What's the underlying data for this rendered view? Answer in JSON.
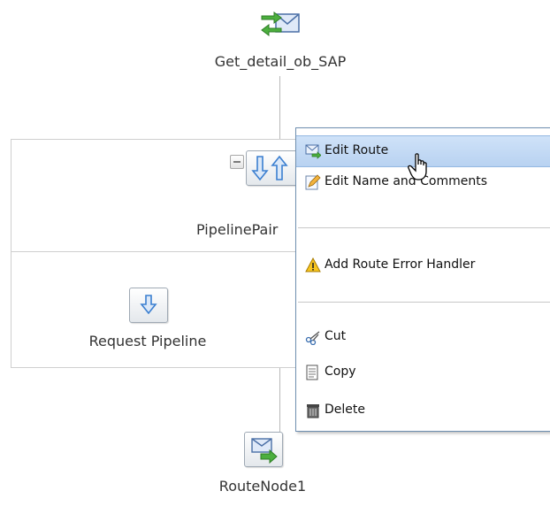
{
  "nodes": {
    "top": {
      "label": "Get_detail_ob_SAP",
      "icon": "envelope-exchange-icon"
    },
    "pipeline_pair": {
      "label": "PipelinePair"
    },
    "request_pipeline": {
      "label": "Request Pipeline"
    },
    "route_node": {
      "label": "RouteNode1"
    }
  },
  "context_menu": {
    "items": [
      {
        "label": "Edit Route",
        "icon": "edit-route-icon",
        "highlighted": true
      },
      {
        "label": "Edit Name and Comments",
        "icon": "edit-pencil-icon"
      },
      {
        "label": "Add Route Error Handler",
        "icon": "warning-icon"
      },
      {
        "label": "Cut",
        "icon": "scissors-icon"
      },
      {
        "label": "Copy",
        "icon": "copy-icon"
      },
      {
        "label": "Delete",
        "icon": "trash-icon"
      }
    ]
  },
  "colors": {
    "menu_highlight": "#b8d2f1",
    "connector": "#b9b9b9",
    "arrow_blue": "#3b7fd0",
    "arrow_green": "#3aa33a"
  }
}
